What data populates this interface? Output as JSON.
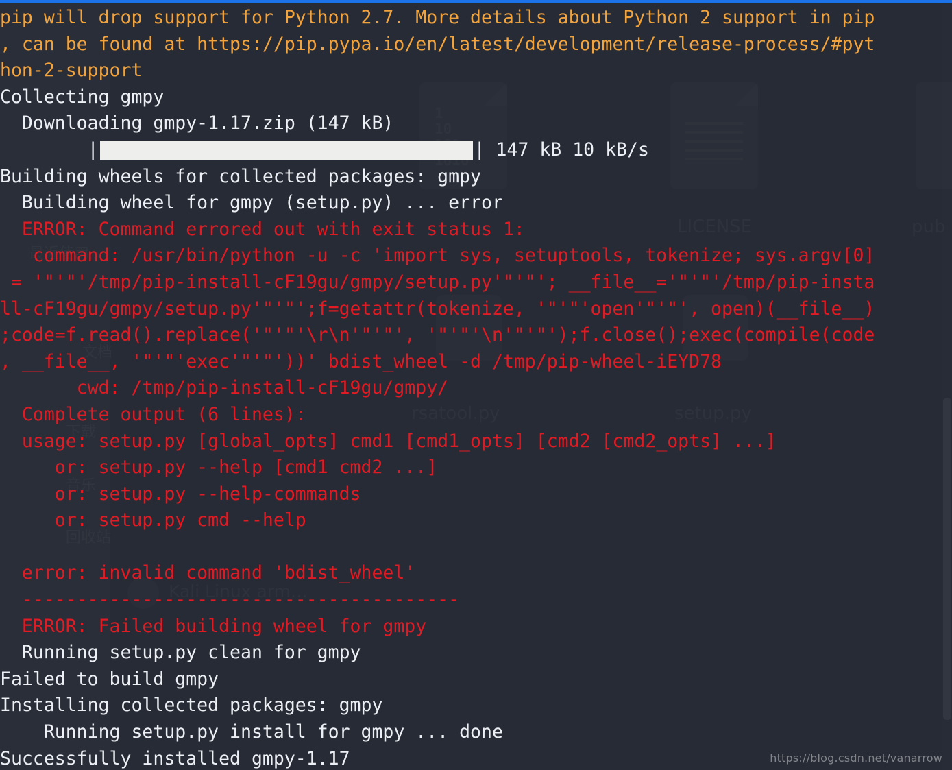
{
  "window": {
    "accent_color": "#1a73e8",
    "background_color": "#272b35",
    "warn_color": "#f2a33c",
    "output_color": "#eceff4",
    "error_color": "#e01b24"
  },
  "watermark": {
    "text": "https://blog.csdn.net/vanarrow"
  },
  "progress": {
    "left_pipe": "|",
    "right_pipe": "|",
    "indent": "        ",
    "size": "147 kB",
    "speed": "10 kB/s",
    "summary": "147 kB 10 kB/s",
    "percent": 100
  },
  "ghost": {
    "sidebar_labels": [
      "最近使用",
      "下载",
      "音乐",
      "回收站",
      "文档"
    ],
    "file_labels": [
      "LICENSE",
      "pub",
      "rsatool.py",
      "setup.py",
      "Kali Linux arm…"
    ],
    "binary_text": "1\n10\n101\n1010"
  },
  "terminal": {
    "lines": [
      {
        "id": "l01",
        "color": "warn",
        "text": "pip will drop support for Python 2.7. More details about Python 2 support in pip"
      },
      {
        "id": "l02",
        "color": "warn",
        "text": ", can be found at https://pip.pypa.io/en/latest/development/release-process/#pyt"
      },
      {
        "id": "l03",
        "color": "warn",
        "text": "hon-2-support"
      },
      {
        "id": "l04",
        "color": "out",
        "text": "Collecting gmpy"
      },
      {
        "id": "l05",
        "color": "out",
        "text": "  Downloading gmpy-1.17.zip (147 kB)"
      },
      {
        "id": "l06",
        "color": "out",
        "type": "progress",
        "text": "        |████████████████████████████████| 147 kB 10 kB/s"
      },
      {
        "id": "l07",
        "color": "out",
        "text": "Building wheels for collected packages: gmpy"
      },
      {
        "id": "l08",
        "color": "out",
        "text": "  Building wheel for gmpy (setup.py) ... error"
      },
      {
        "id": "l09",
        "color": "err",
        "text": "  ERROR: Command errored out with exit status 1:"
      },
      {
        "id": "l10",
        "color": "err",
        "text": "   command: /usr/bin/python -u -c 'import sys, setuptools, tokenize; sys.argv[0]"
      },
      {
        "id": "l11",
        "color": "err",
        "text": " = '\"'\"'/tmp/pip-install-cF19gu/gmpy/setup.py'\"'\"'; __file__='\"'\"'/tmp/pip-insta"
      },
      {
        "id": "l12",
        "color": "err",
        "text": "ll-cF19gu/gmpy/setup.py'\"'\"';f=getattr(tokenize, '\"'\"'open'\"'\"', open)(__file__)"
      },
      {
        "id": "l13",
        "color": "err",
        "text": ";code=f.read().replace('\"'\"'\\r\\n'\"'\"', '\"'\"'\\n'\"'\"');f.close();exec(compile(code"
      },
      {
        "id": "l14",
        "color": "err",
        "text": ", __file__, '\"'\"'exec'\"'\"'))' bdist_wheel -d /tmp/pip-wheel-iEYD78"
      },
      {
        "id": "l15",
        "color": "err",
        "text": "       cwd: /tmp/pip-install-cF19gu/gmpy/"
      },
      {
        "id": "l16",
        "color": "err",
        "text": "  Complete output (6 lines):"
      },
      {
        "id": "l17",
        "color": "err",
        "text": "  usage: setup.py [global_opts] cmd1 [cmd1_opts] [cmd2 [cmd2_opts] ...]"
      },
      {
        "id": "l18",
        "color": "err",
        "text": "     or: setup.py --help [cmd1 cmd2 ...]"
      },
      {
        "id": "l19",
        "color": "err",
        "text": "     or: setup.py --help-commands"
      },
      {
        "id": "l20",
        "color": "err",
        "text": "     or: setup.py cmd --help"
      },
      {
        "id": "l21",
        "color": "err",
        "text": ""
      },
      {
        "id": "l22",
        "color": "err",
        "text": "  error: invalid command 'bdist_wheel'"
      },
      {
        "id": "l23",
        "color": "err",
        "text": "  ----------------------------------------"
      },
      {
        "id": "l24",
        "color": "err",
        "text": "  ERROR: Failed building wheel for gmpy"
      },
      {
        "id": "l25",
        "color": "out",
        "text": "  Running setup.py clean for gmpy"
      },
      {
        "id": "l26",
        "color": "out",
        "text": "Failed to build gmpy"
      },
      {
        "id": "l27",
        "color": "out",
        "text": "Installing collected packages: gmpy"
      },
      {
        "id": "l28",
        "color": "out",
        "text": "    Running setup.py install for gmpy ... done"
      },
      {
        "id": "l29",
        "color": "out",
        "text": "Successfully installed gmpy-1.17"
      }
    ]
  }
}
